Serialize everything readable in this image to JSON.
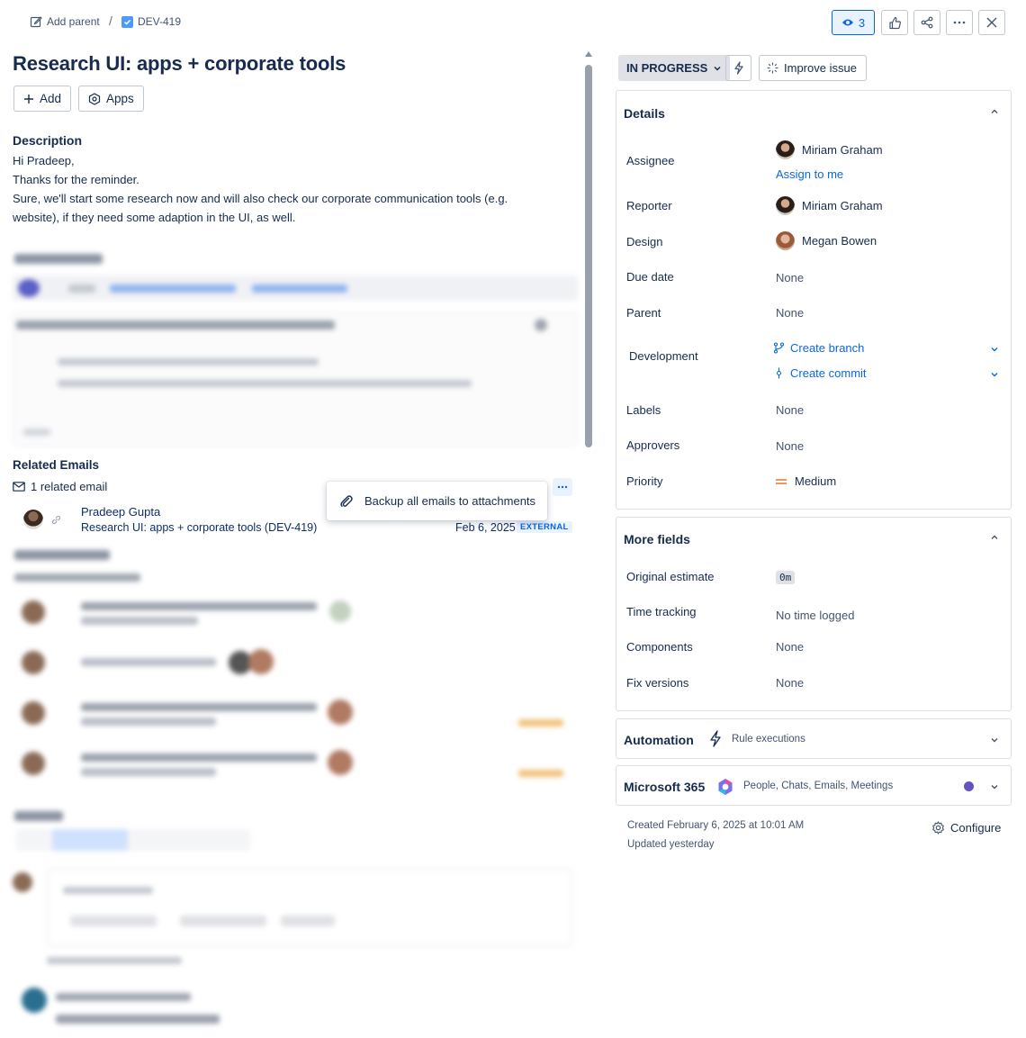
{
  "breadcrumb": {
    "add_parent": "Add parent",
    "separator": "/",
    "issue_key": "DEV-419"
  },
  "toolbar": {
    "watchers_count": "3"
  },
  "issue": {
    "title": "Research UI: apps + corporate tools",
    "add_label": "Add",
    "apps_label": "Apps",
    "description_heading": "Description",
    "description_lines": [
      "Hi Pradeep,",
      "Thanks for the reminder.",
      "Sure, we'll start some research now and will also check our corporate communication tools (e.g. website), if they need some adaption in the UI, as well."
    ]
  },
  "related_emails": {
    "heading": "Related Emails",
    "count_label": "1 related email",
    "menu_item": "Backup all emails to attachments",
    "email": {
      "from": "Pradeep Gupta",
      "subject": "Research UI: apps + corporate tools (DEV-419)",
      "date": "Feb 6, 2025",
      "badge": "EXTERNAL"
    }
  },
  "status": {
    "label": "IN PROGRESS",
    "improve_label": "Improve issue"
  },
  "details": {
    "heading": "Details",
    "assignee_label": "Assignee",
    "assignee": "Miriam Graham",
    "assign_to_me": "Assign to me",
    "reporter_label": "Reporter",
    "reporter": "Miriam Graham",
    "design_label": "Design",
    "design": "Megan Bowen",
    "due_date_label": "Due date",
    "due_date": "None",
    "parent_label": "Parent",
    "parent": "None",
    "development_label": "Development",
    "create_branch": "Create branch",
    "create_commit": "Create commit",
    "labels_label": "Labels",
    "labels": "None",
    "approvers_label": "Approvers",
    "approvers": "None",
    "priority_label": "Priority",
    "priority": "Medium"
  },
  "more_fields": {
    "heading": "More fields",
    "original_estimate_label": "Original estimate",
    "original_estimate": "0m",
    "time_tracking_label": "Time tracking",
    "time_tracking": "No time logged",
    "components_label": "Components",
    "components": "None",
    "fix_versions_label": "Fix versions",
    "fix_versions": "None"
  },
  "automation": {
    "heading": "Automation",
    "sub": "Rule executions"
  },
  "m365": {
    "heading": "Microsoft 365",
    "sub": "People, Chats, Emails, Meetings",
    "dot_color": "#6554c0"
  },
  "footer": {
    "created": "Created February 6, 2025 at 10:01 AM",
    "updated": "Updated yesterday",
    "configure": "Configure"
  },
  "colors": {
    "accent": "#0c66e4",
    "priority_medium": "#e2762c"
  }
}
